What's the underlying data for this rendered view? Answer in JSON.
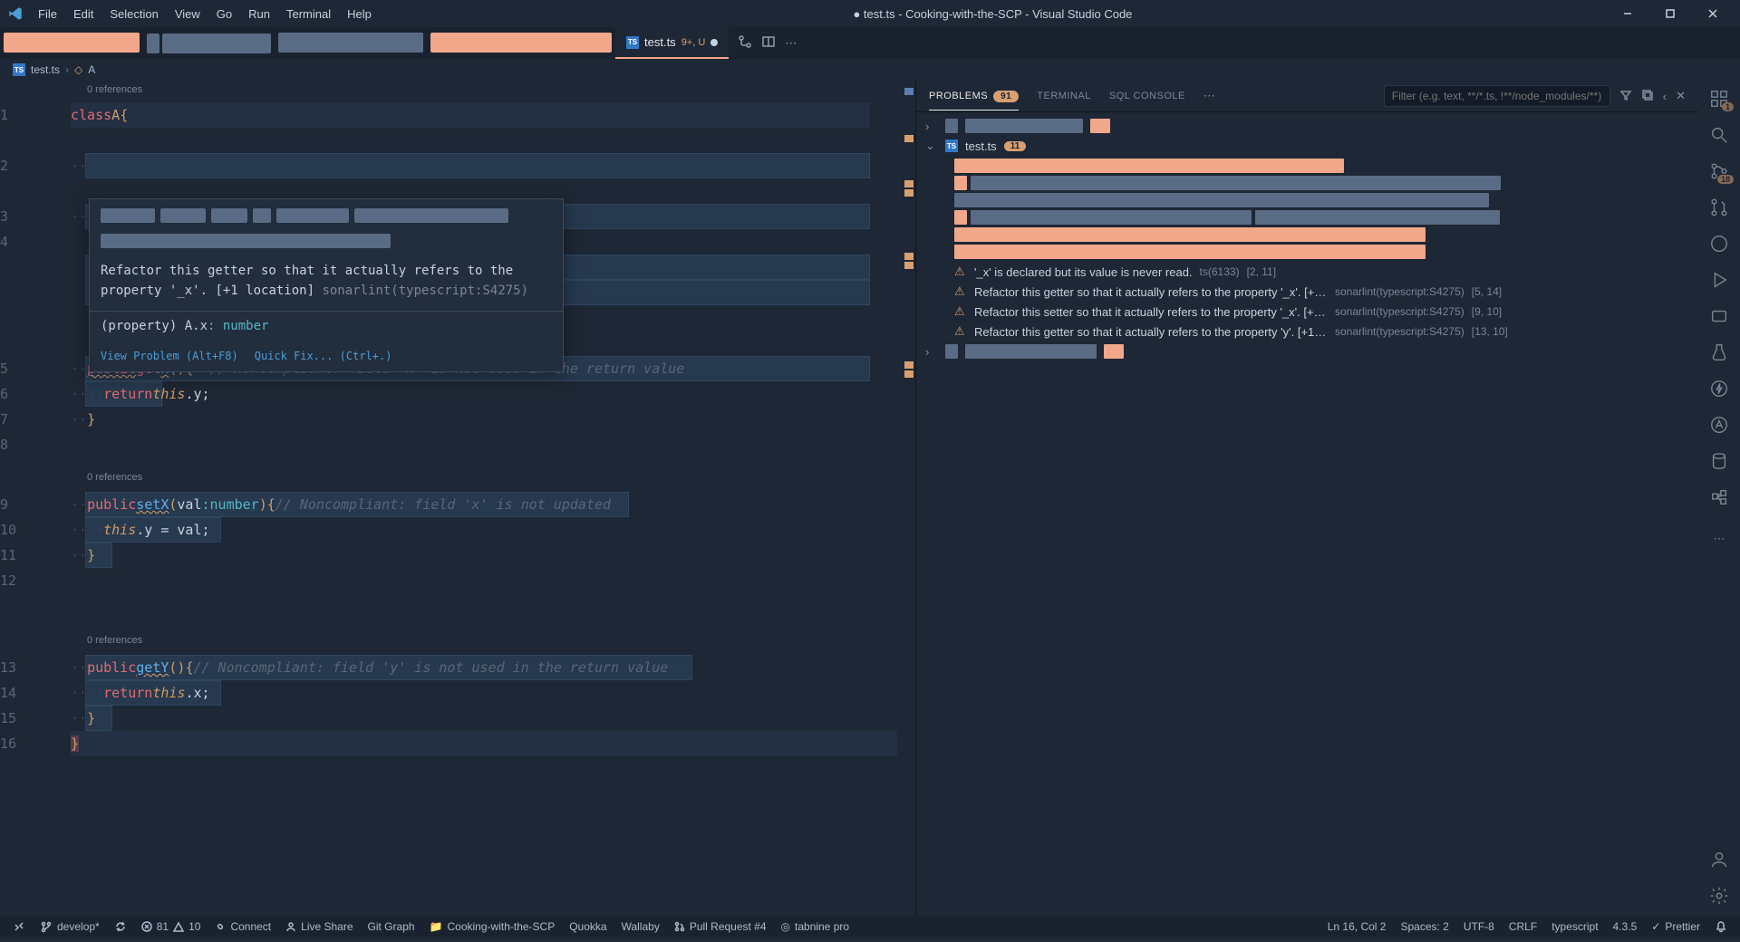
{
  "titlebar": {
    "menus": [
      "File",
      "Edit",
      "Selection",
      "View",
      "Go",
      "Run",
      "Terminal",
      "Help"
    ],
    "title": "● test.ts - Cooking-with-the-SCP - Visual Studio Code"
  },
  "tab": {
    "filename": "test.ts",
    "stats": "9+, U"
  },
  "breadcrumb": {
    "file": "test.ts",
    "symbol": "A"
  },
  "codelens": {
    "refs1": "0 references",
    "refs2": "0 references",
    "refs3": "0 references"
  },
  "editor": {
    "line_numbers": [
      "1",
      "2",
      "3",
      "4",
      "5",
      "6",
      "7",
      "8",
      "9",
      "10",
      "11",
      "12",
      "13",
      "14",
      "15",
      "16"
    ],
    "l1": {
      "kw": "class",
      "name": "A",
      "brace": "{"
    },
    "l5": {
      "visibility": "public",
      "accessor": "get",
      "name": "x",
      "params": "()",
      "brace": "{",
      "comment": "// Noncompliant: field 'x' is not used in the return value"
    },
    "l6": {
      "ret": "return",
      "this": "this",
      "prop": ".y",
      "semi": ";"
    },
    "l7": {
      "brace": "}"
    },
    "l9": {
      "visibility": "public",
      "name": "setX",
      "paramName": "val",
      "colon": ":",
      "type": "number",
      "close": ")",
      "brace": "{",
      "comment": "// Noncompliant: field 'x' is not updated"
    },
    "l10": {
      "this": "this",
      "prop": ".y",
      "eq": " = ",
      "val": "val",
      "semi": ";"
    },
    "l11": {
      "brace": "}"
    },
    "l13": {
      "visibility": "public",
      "name": "getY",
      "params": "()",
      "brace": "{",
      "comment": "// Noncompliant: field 'y' is not used in the return value"
    },
    "l14": {
      "ret": "return",
      "this": "this",
      "prop": ".x",
      "semi": ";"
    },
    "l15": {
      "brace": "}"
    },
    "l16": {
      "brace": "}"
    }
  },
  "hover": {
    "message_pre": "Refactor this getter so that it actually refers to the property '_x'. ",
    "extra": "[+1 location]",
    "source": "sonarlint(typescript:S4275)",
    "signature": "(property) A.x: number",
    "action1": "View Problem (Alt+F8)",
    "action2": "Quick Fix... (Ctrl+.)"
  },
  "panel": {
    "tabs": {
      "problems": "PROBLEMS",
      "terminal": "TERMINAL",
      "sql": "SQL CONSOLE"
    },
    "badge": "91",
    "filter_placeholder": "Filter (e.g. text, **/*.ts, !**/node_modules/**)",
    "file": "test.ts",
    "file_badge": "11",
    "items": [
      {
        "severity": "info",
        "msg": "'_x' is declared but its value is never read.",
        "src": "ts(6133)",
        "loc": "[2, 11]"
      },
      {
        "severity": "warn",
        "msg": "Refactor this getter so that it actually refers to the property '_x'. [+1 locati...",
        "src": "sonarlint(typescript:S4275)",
        "loc": "[5, 14]"
      },
      {
        "severity": "warn",
        "msg": "Refactor this setter so that it actually refers to the property '_x'. [+1 locati...",
        "src": "sonarlint(typescript:S4275)",
        "loc": "[9, 10]"
      },
      {
        "severity": "warn",
        "msg": "Refactor this getter so that it actually refers to the property 'y'. [+1 locat...",
        "src": "sonarlint(typescript:S4275)",
        "loc": "[13, 10]"
      }
    ]
  },
  "statusbar": {
    "branch": "develop*",
    "errors": "81",
    "warnings": "10",
    "connect": "Connect",
    "liveshare": "Live Share",
    "gitgraph": "Git Graph",
    "project": "Cooking-with-the-SCP",
    "quokka": "Quokka",
    "wallaby": "Wallaby",
    "pr": "Pull Request #4",
    "tabnine": "tabnine pro",
    "pos": "Ln 16, Col 2",
    "spaces": "Spaces: 2",
    "enc": "UTF-8",
    "eol": "CRLF",
    "lang": "typescript",
    "ver": "4.3.5",
    "prettier": "Prettier"
  },
  "activity_badges": {
    "extensions": "1",
    "pr": "18"
  }
}
